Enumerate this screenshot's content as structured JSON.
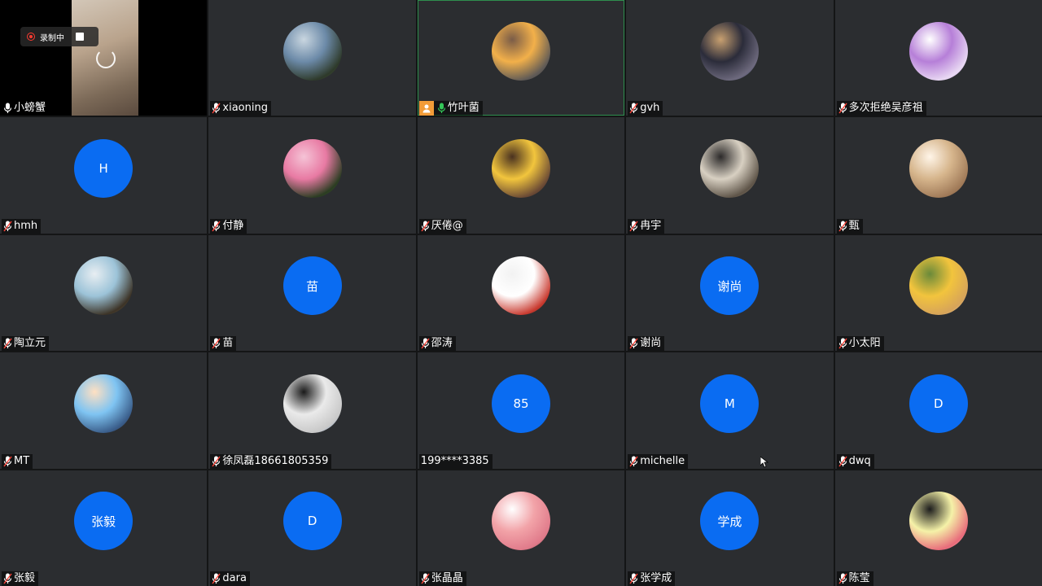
{
  "recording": {
    "label": "录制中"
  },
  "tiles": [
    {
      "name": "小螃蟹",
      "mic": "active",
      "type": "video"
    },
    {
      "name": "xiaoning",
      "mic": "muted",
      "type": "photo",
      "avatar": "mountain-lake-photo",
      "colors": [
        "#6c8aa8",
        "#c9d6e0",
        "#4a5a3c",
        "#2e3a2a"
      ]
    },
    {
      "name": "竹叶菌",
      "mic": "active-green",
      "type": "photo",
      "avatar": "sunset-sea-photo",
      "host": true,
      "colors": [
        "#f2b04a",
        "#7a5c48",
        "#3c3431",
        "#5f5a56"
      ]
    },
    {
      "name": "gvh",
      "mic": "muted",
      "type": "photo",
      "avatar": "basketball-photo",
      "colors": [
        "#2b2c3a",
        "#c8a070",
        "#1c2d5e",
        "#6e6a7e"
      ]
    },
    {
      "name": "多次拒绝吴彦祖",
      "mic": "muted",
      "type": "photo",
      "avatar": "cartoon-ghost-photo",
      "colors": [
        "#b67fd8",
        "#ffffff",
        "#b67fd8",
        "#e9d9f3"
      ]
    },
    {
      "name": "hmh",
      "mic": "muted",
      "type": "initial",
      "initial": "H"
    },
    {
      "name": "付静",
      "mic": "muted",
      "type": "photo",
      "avatar": "pink-flower-photo",
      "colors": [
        "#e87aa3",
        "#f5c3d6",
        "#3f5a2c",
        "#2b3d22"
      ]
    },
    {
      "name": "厌倦@",
      "mic": "muted",
      "type": "photo",
      "avatar": "basketball-player-photo",
      "colors": [
        "#f2c53d",
        "#4a3220",
        "#2a1d18",
        "#6b4a35"
      ]
    },
    {
      "name": "冉宇",
      "mic": "muted",
      "type": "photo",
      "avatar": "vr-headset-photo",
      "colors": [
        "#d8d0c2",
        "#2c2a2a",
        "#9a8a78",
        "#5e5448"
      ]
    },
    {
      "name": "甄",
      "mic": "muted",
      "type": "photo",
      "avatar": "dog-photo",
      "colors": [
        "#d6b58c",
        "#fff5e8",
        "#6a4a32",
        "#a07a58"
      ]
    },
    {
      "name": "陶立元",
      "mic": "muted",
      "type": "photo",
      "avatar": "road-sky-photo",
      "colors": [
        "#9cc3d8",
        "#e8eef2",
        "#7a6a52",
        "#3c3326"
      ]
    },
    {
      "name": "苗",
      "mic": "muted",
      "type": "initial",
      "initial": "苗"
    },
    {
      "name": "邵涛",
      "mic": "muted",
      "type": "photo",
      "avatar": "calligraphy-photo",
      "colors": [
        "#ffffff",
        "#f2f2f2",
        "#222222",
        "#c93a2f"
      ]
    },
    {
      "name": "谢尚",
      "mic": "muted",
      "type": "initial",
      "initial": "谢尚"
    },
    {
      "name": "小太阳",
      "mic": "muted",
      "type": "photo",
      "avatar": "sunflower-girl-photo",
      "colors": [
        "#f2c43d",
        "#6a8a3a",
        "#f6e4c8",
        "#d6a35a"
      ]
    },
    {
      "name": "MT",
      "mic": "muted",
      "type": "photo",
      "avatar": "cartoon-man-photo",
      "colors": [
        "#7fc4f2",
        "#ffe0c2",
        "#2b2b2b",
        "#3a5d8a"
      ]
    },
    {
      "name": "徐凤磊18661805359",
      "mic": "muted",
      "type": "photo",
      "avatar": "office-photo",
      "colors": [
        "#eaeaea",
        "#1a1a1a",
        "#3d78c8",
        "#c8c8c8"
      ]
    },
    {
      "name": "199****3385",
      "mic": "none",
      "type": "initial",
      "initial": "85"
    },
    {
      "name": "michelle",
      "mic": "muted",
      "type": "initial",
      "initial": "M"
    },
    {
      "name": "dwq",
      "mic": "muted",
      "type": "initial",
      "initial": "D"
    },
    {
      "name": "张毅",
      "mic": "muted",
      "type": "initial",
      "initial": "张毅"
    },
    {
      "name": "dara",
      "mic": "muted",
      "type": "initial",
      "initial": "D"
    },
    {
      "name": "张晶晶",
      "mic": "muted",
      "type": "photo",
      "avatar": "cartoon-girl-photo",
      "colors": [
        "#f2a3a8",
        "#ffffff",
        "#6a4a3a",
        "#e07a8a"
      ]
    },
    {
      "name": "张学成",
      "mic": "muted",
      "type": "initial",
      "initial": "学成"
    },
    {
      "name": "陈莹",
      "mic": "muted",
      "type": "photo",
      "avatar": "cartoon-kid-photo",
      "colors": [
        "#f5f2a8",
        "#1c1c1c",
        "#ffe0c8",
        "#e86a7a"
      ]
    }
  ]
}
